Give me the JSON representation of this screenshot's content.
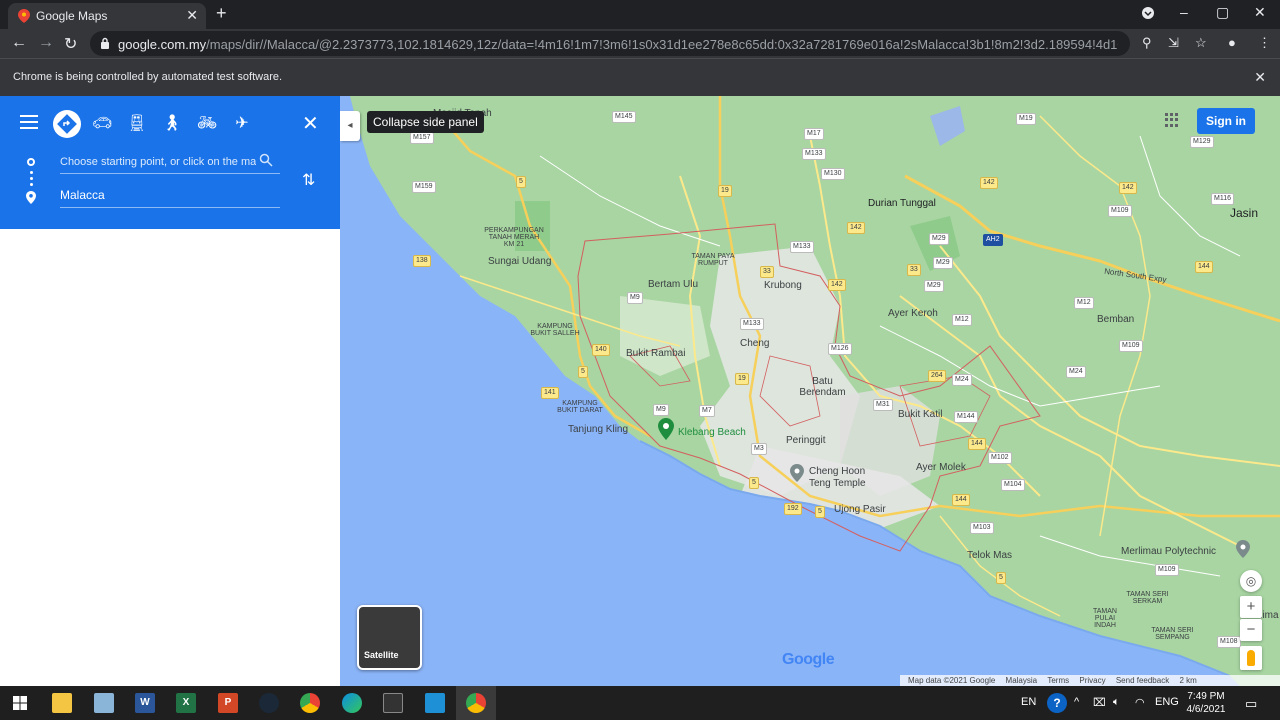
{
  "browser": {
    "tab_title": "Google Maps",
    "url_host": "google.com.my",
    "url_rest": "/maps/dir//Malacca/@2.2373773,102.1814629,12z/data=!4m16!1m7!3m6!1s0x31d1ee278e8c65dd:0x32a7281769e016a!2sMalacca!3b1!8m2!3d2.189594!4d102.2500868!4m7!1m0!...",
    "info_message": "Chrome is being controlled by automated test software."
  },
  "directions": {
    "start_placeholder": "Choose starting point, or click on the map",
    "destination": "Malacca",
    "modes": [
      "directions-icon",
      "car-icon",
      "transit-icon",
      "walk-icon",
      "bicycle-icon",
      "flight-icon"
    ]
  },
  "map": {
    "tooltip": "Collapse side panel",
    "signin_label": "Sign in",
    "satellite_label": "Satellite",
    "logo_text": "Google",
    "attribution": {
      "data": "Map data ©2021 Google",
      "region": "Malaysia",
      "terms": "Terms",
      "privacy": "Privacy",
      "feedback": "Send feedback",
      "scale": "2 km"
    },
    "places": {
      "masjid_tanah": "Masjid Tanah",
      "durian_tunggal": "Durian Tunggal",
      "jasin": "Jasin",
      "sungai_udang": "Sungai Udang",
      "bertam_ulu": "Bertam Ulu",
      "krubong": "Krubong",
      "ayer_keroh": "Ayer Keroh",
      "bemban": "Bemban",
      "bukit_rambai": "Bukit Rambai",
      "cheng": "Cheng",
      "batu_berendam": "Batu Berendam",
      "bukit_katil": "Bukit Katil",
      "tanjung_kling": "Tanjung Kling",
      "klebang_beach": "Klebang Beach",
      "peringgit": "Peringgit",
      "ayer_molek": "Ayer Molek",
      "cheng_hoon_teng": "Cheng Hoon Teng Temple",
      "ujong_pasir": "Ujong Pasir",
      "telok_mas": "Telok Mas",
      "merlimau_poly": "Merlimau Polytechnic",
      "merlimau": "Merlima",
      "perkampungan": "PERKAMPUNGAN TANAH MERAH KM 21",
      "taman_paya_rumput": "TAMAN PAYA RUMPUT",
      "kampung_salleh": "KAMPUNG BUKIT SALLEH",
      "kampung_darat": "KAMPUNG BUKIT DARAT",
      "taman_pulai": "TAMAN PULAI INDAH",
      "taman_serkam": "TAMAN SERI SERKAM",
      "taman_sempang": "TAMAN SERI SEMPANG",
      "north_south": "North South Expy"
    },
    "shields": {
      "m145": "M145",
      "m157": "M157",
      "m17": "M17",
      "m133a": "M133",
      "m19a": "M19",
      "m129": "M129",
      "m130": "M130",
      "m159": "M159",
      "m133b": "M133",
      "s142a": "142",
      "s142b": "142",
      "m116": "M116",
      "m109a": "M109",
      "m29a": "M29",
      "ah2": "AH2",
      "s138": "138",
      "s33a": "33",
      "s33b": "33",
      "m29b": "M29",
      "s144a": "144",
      "s142c": "142",
      "m29c": "M29",
      "m9a": "M9",
      "m133c": "M133",
      "m12a": "M12",
      "m12b": "M12",
      "s140": "140",
      "m126": "M126",
      "m109b": "M109",
      "s5a": "5",
      "s19": "19",
      "s264": "264",
      "m24a": "M24",
      "m24b": "M24",
      "s141": "141",
      "m31": "M31",
      "m144": "M144",
      "m9b": "M9",
      "m7": "M7",
      "s144b": "144",
      "m3": "M3",
      "m102": "M102",
      "s5b": "5",
      "m104": "M104",
      "s144c": "144",
      "s192": "192",
      "s5c": "5",
      "s19b": "19",
      "m103": "M103",
      "m109c": "M109",
      "s5d": "5",
      "m108": "M108",
      "s5e": "5"
    }
  },
  "taskbar": {
    "lang": "EN",
    "input_lang": "ENG",
    "time": "7:49 PM",
    "date": "4/6/2021"
  }
}
